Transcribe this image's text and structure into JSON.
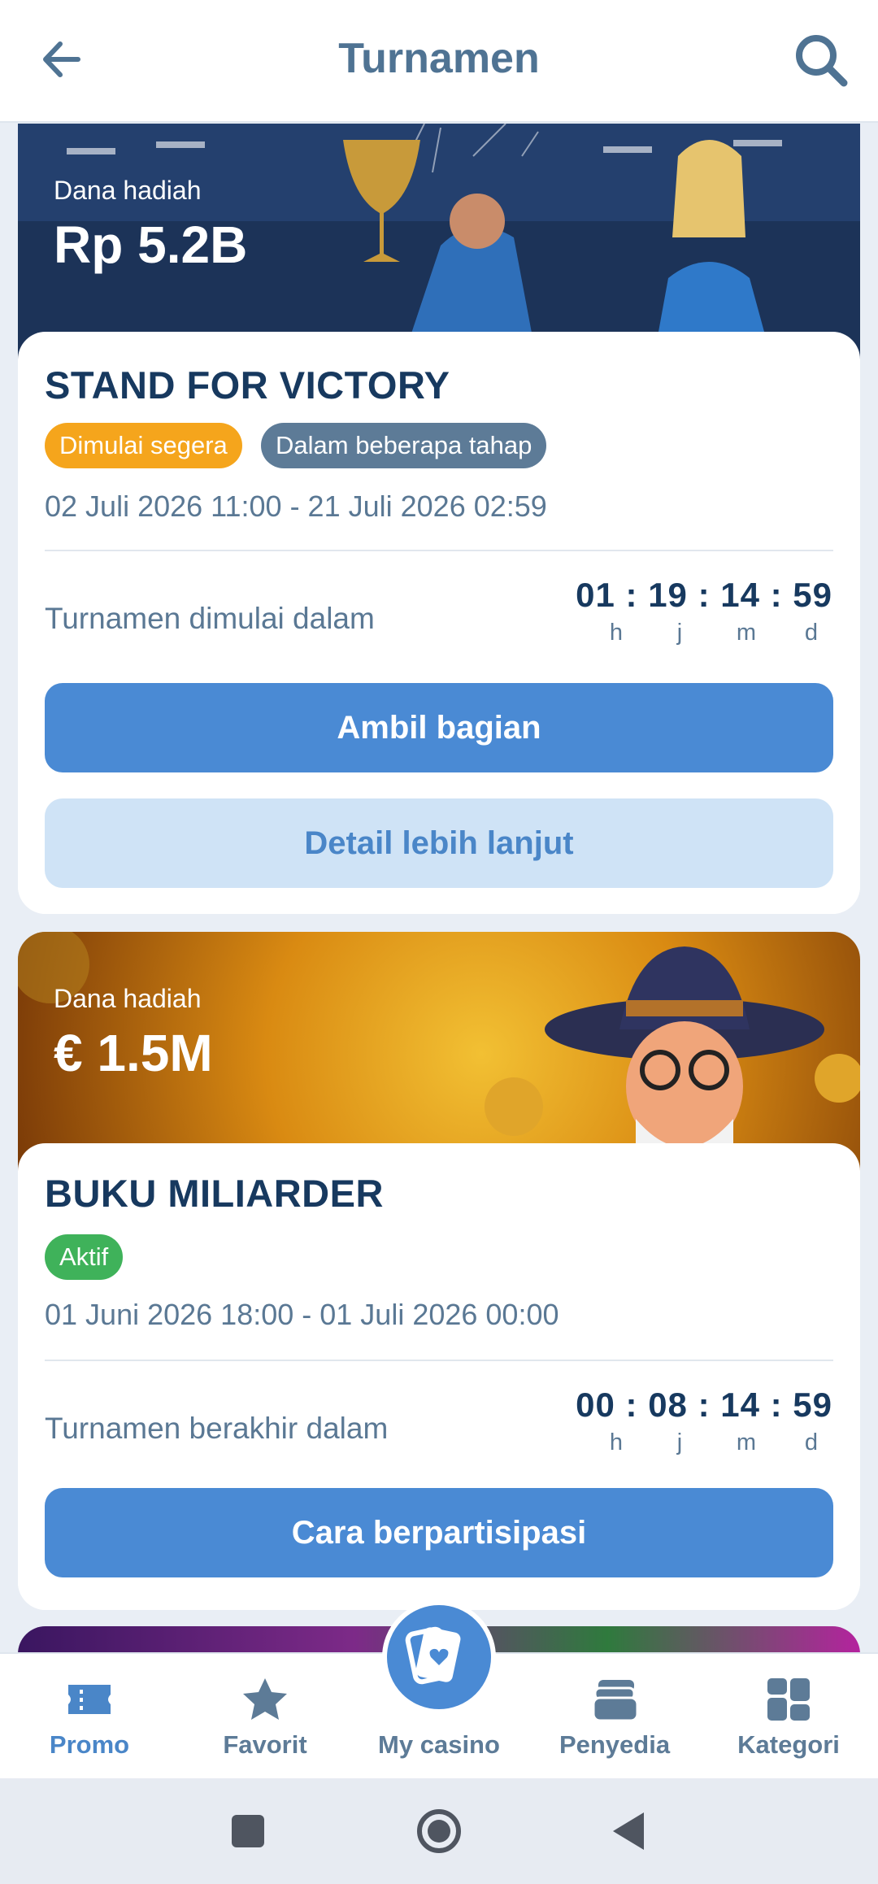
{
  "header": {
    "title": "Turnamen",
    "back_icon": "back-arrow-icon",
    "search_icon": "search-icon"
  },
  "tournaments": [
    {
      "prize_label": "Dana hadiah",
      "prize_value": "Rp 5.2B",
      "name": "STAND FOR VICTORY",
      "badges": [
        "Dimulai segera",
        "Dalam beberapa tahap"
      ],
      "dates": "02 Juli 2026 11:00 - 21 Juli 2026 02:59",
      "countdown_label": "Turnamen dimulai dalam",
      "timer": "01 : 19 : 14 : 59",
      "units": [
        "h",
        "j",
        "m",
        "d"
      ],
      "primary_button": "Ambil bagian",
      "secondary_button": "Detail lebih lanjut"
    },
    {
      "prize_label": "Dana hadiah",
      "prize_value": "€ 1.5M",
      "name": "BUKU MILIARDER",
      "badges": [
        "Aktif"
      ],
      "dates": "01 Juni 2026 18:00 - 01 Juli 2026 00:00",
      "countdown_label": "Turnamen berakhir dalam",
      "timer": "00 : 08 : 14 : 59",
      "units": [
        "h",
        "j",
        "m",
        "d"
      ],
      "primary_button": "Cara berpartisipasi"
    }
  ],
  "bottom_nav": {
    "items": [
      {
        "label": "Promo",
        "icon": "ticket-icon",
        "active": true
      },
      {
        "label": "Favorit",
        "icon": "star-icon",
        "active": false
      },
      {
        "label": "My casino",
        "icon": "cards-icon",
        "active": false
      },
      {
        "label": "Penyedia",
        "icon": "stack-icon",
        "active": false
      },
      {
        "label": "Kategori",
        "icon": "grid-icon",
        "active": false
      }
    ]
  },
  "colors": {
    "accent": "#4a8ad4",
    "title": "#17395f",
    "badge_orange": "#f5a51c",
    "badge_slate": "#5d7b97",
    "badge_green": "#3fb25a"
  }
}
